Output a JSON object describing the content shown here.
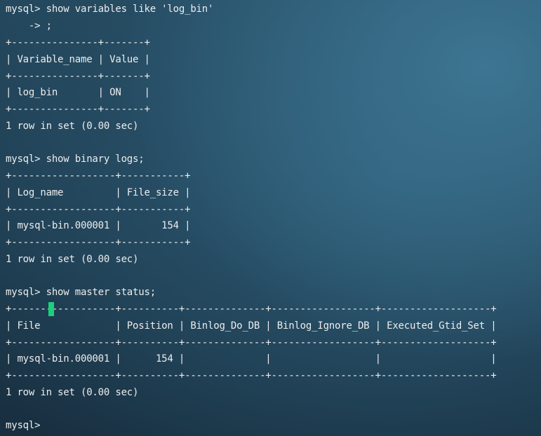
{
  "terminal": {
    "lines": [
      "mysql> show variables like 'log_bin'",
      "    -> ;",
      "+---------------+-------+",
      "| Variable_name | Value |",
      "+---------------+-------+",
      "| log_bin       | ON    |",
      "+---------------+-------+",
      "1 row in set (0.00 sec)",
      "",
      "mysql> show binary logs;",
      "+------------------+-----------+",
      "| Log_name         | File_size |",
      "+------------------+-----------+",
      "| mysql-bin.000001 |       154 |",
      "+------------------+-----------+",
      "1 row in set (0.00 sec)",
      "",
      "mysql> show master status;",
      "+------------------+----------+--------------+------------------+-------------------+",
      "| File             | Position | Binlog_Do_DB | Binlog_Ignore_DB | Executed_Gtid_Set |",
      "+------------------+----------+--------------+------------------+-------------------+",
      "| mysql-bin.000001 |      154 |              |                  |                   |",
      "+------------------+----------+--------------+------------------+-------------------+",
      "1 row in set (0.00 sec)",
      "",
      "mysql>"
    ],
    "cursor_color": "#1ad17c",
    "text_color": "#ededed"
  }
}
